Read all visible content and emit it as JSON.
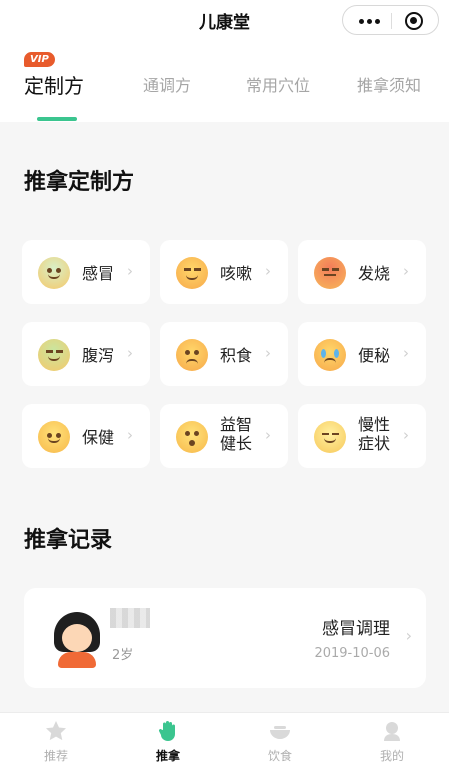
{
  "header": {
    "title": "儿康堂"
  },
  "tabs": [
    {
      "label": "定制方",
      "badge": "VIP",
      "active": true
    },
    {
      "label": "通调方"
    },
    {
      "label": "常用穴位"
    },
    {
      "label": "推拿须知"
    }
  ],
  "custom": {
    "section_title": "推拿定制方",
    "items": [
      {
        "label": "感冒",
        "icon": "sick-face-icon"
      },
      {
        "label": "咳嗽",
        "icon": "squint-face-icon"
      },
      {
        "label": "发烧",
        "icon": "hot-face-icon"
      },
      {
        "label": "腹泻",
        "icon": "nauseated-face-icon"
      },
      {
        "label": "积食",
        "icon": "worried-face-icon"
      },
      {
        "label": "便秘",
        "icon": "crying-face-icon"
      },
      {
        "label": "保健",
        "icon": "smiling-face-icon"
      },
      {
        "label": "益智\n健长",
        "icon": "surprised-face-icon"
      },
      {
        "label": "慢性\n症状",
        "icon": "calm-face-icon"
      }
    ]
  },
  "records": {
    "section_title": "推拿记录",
    "items": [
      {
        "age": "2岁",
        "title": "感冒调理",
        "date": "2019-10-06"
      }
    ]
  },
  "bottom_nav": [
    {
      "label": "推荐",
      "icon": "star-icon"
    },
    {
      "label": "推拿",
      "icon": "hand-icon",
      "active": true
    },
    {
      "label": "饮食",
      "icon": "bowl-icon"
    },
    {
      "label": "我的",
      "icon": "user-icon"
    }
  ],
  "colors": {
    "accent": "#3bc58f",
    "vip": "#e85b2c"
  }
}
